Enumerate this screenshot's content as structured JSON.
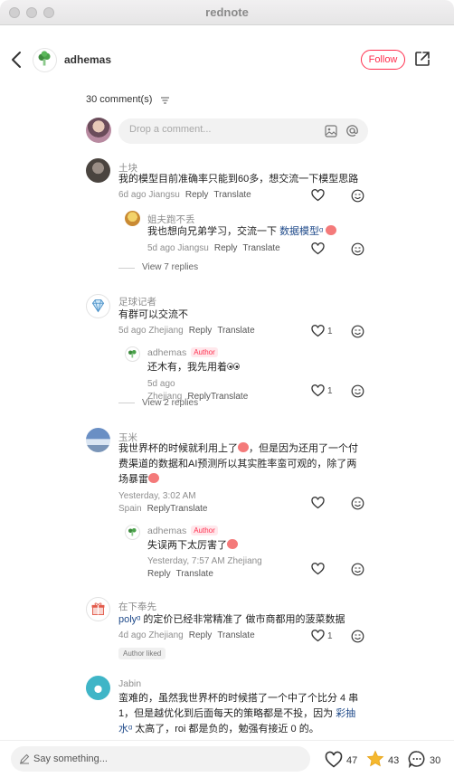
{
  "window": {
    "title": "rednote"
  },
  "header": {
    "author": "adhemas",
    "follow_label": "Follow"
  },
  "comments_count": "30 comment(s)",
  "composer": {
    "placeholder": "Drop a comment..."
  },
  "comments": [
    {
      "name": "土块",
      "text": "我的模型目前准确率只能到60多，想交流一下模型思路",
      "meta": "6d ago Jiangsu",
      "reply": "Reply",
      "translate": "Translate",
      "likes": "",
      "replies": [
        {
          "name": "姐夫跑不丢",
          "text_prefix": "我也想向兄弟学习，交流一下 ",
          "link": "数据模型ᵅ",
          "meta": "5d ago Jiangsu",
          "reply": "Reply",
          "translate": "Translate"
        }
      ],
      "view_replies": "View 7 replies"
    },
    {
      "name": "足球记者",
      "text": "有群可以交流不",
      "meta": "5d ago Zhejiang",
      "reply": "Reply",
      "translate": "Translate",
      "likes": "1",
      "replies": [
        {
          "name": "adhemas",
          "author_tag": "Author",
          "text": "还木有，我先用着",
          "meta": "5d ago Zhejiang",
          "reply": "Reply",
          "translate": "Translate",
          "likes": "1"
        }
      ],
      "view_replies": "View 2 replies"
    },
    {
      "name": "玉米",
      "text_line1": "我世界杯的时候就利用上了",
      "text_line1b": "，但是因为还用了一个付",
      "text_line2": "费渠道的数据和AI预测所以其实胜率蛮可观的，除了两",
      "text_line3": "场暴雷",
      "meta": "Yesterday, 3:02 AM Spain",
      "reply": "Reply",
      "translate": "Translate",
      "likes": "",
      "replies": [
        {
          "name": "adhemas",
          "author_tag": "Author",
          "text": "失误两下太厉害了",
          "meta": "Yesterday, 7:57 AM Zhejiang",
          "reply": "Reply",
          "translate": "Translate"
        }
      ]
    },
    {
      "name": "在下奉先",
      "link": "polyᵅ",
      "text": " 的定价已经非常精准了 做市商都用的菠菜数据",
      "meta": "4d ago Zhejiang",
      "reply": "Reply",
      "translate": "Translate",
      "likes": "1",
      "badge": "Author liked"
    },
    {
      "name": "Jabin",
      "text_line1": "蛮难的，虽然我世界杯的时候搭了一个中了个比分 4 串",
      "text_line2a": "1，但是越优化到后面每天的策略都是不投，因为 ",
      "link1": "彩抽",
      "link2": "水ᵅ",
      "text_line3": " 太高了，roi 都是负的，勉强有接近 0 的。"
    }
  ],
  "bottom_bar": {
    "say_placeholder": "Say something...",
    "likes": "47",
    "stars": "43",
    "comments": "30"
  },
  "colors": {
    "accent": "#ff2e4d",
    "link": "#1f4a8a",
    "meta": "#8e8e8e"
  }
}
